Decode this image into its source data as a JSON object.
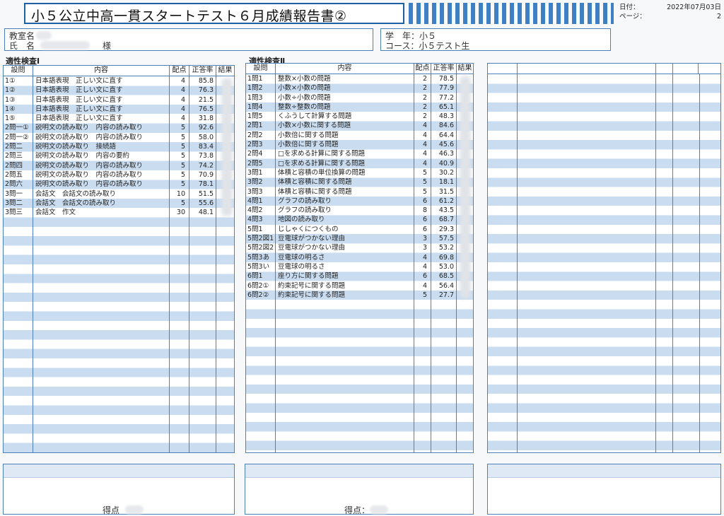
{
  "header": {
    "title": "小５公立中高一貫スタートテスト６月成績報告書②",
    "date_label": "日付：",
    "date_value": "2022年07月03日",
    "page_label": "ページ：",
    "page_value": "2"
  },
  "info": {
    "classroom_label": "教室名",
    "name_label": "氏　名",
    "honorific": "様",
    "grade_label": "学　年：",
    "grade_value": "小５",
    "course_label": "コース：",
    "course_value": "小５テスト生"
  },
  "table_headers": {
    "question": "設問",
    "content": "内容",
    "points": "配点",
    "rate": "正答率",
    "result": "結果"
  },
  "section1": {
    "title": "適性検査Ⅰ",
    "rows": [
      {
        "q": "1①",
        "c": "日本語表現　正しい文に直す",
        "p": "4",
        "r": "85.8"
      },
      {
        "q": "1②",
        "c": "日本語表現　正しい文に直す",
        "p": "4",
        "r": "76.3"
      },
      {
        "q": "1③",
        "c": "日本語表現　正しい文に直す",
        "p": "4",
        "r": "21.5"
      },
      {
        "q": "1④",
        "c": "日本語表現　正しい文に直す",
        "p": "4",
        "r": "76.5"
      },
      {
        "q": "1⑤",
        "c": "日本語表現　正しい文に直す",
        "p": "4",
        "r": "31.8"
      },
      {
        "q": "2問一①",
        "c": "説明文の読み取り　内容の読み取り",
        "p": "5",
        "r": "92.6"
      },
      {
        "q": "2問一②",
        "c": "説明文の読み取り　内容の読み取り",
        "p": "5",
        "r": "58.0"
      },
      {
        "q": "2問二",
        "c": "説明文の読み取り　接続語",
        "p": "5",
        "r": "83.4"
      },
      {
        "q": "2問三",
        "c": "説明文の読み取り　内容の要約",
        "p": "5",
        "r": "73.8"
      },
      {
        "q": "2問四",
        "c": "説明文の読み取り　内容の読み取り",
        "p": "5",
        "r": "74.2"
      },
      {
        "q": "2問五",
        "c": "説明文の読み取り　内容の読み取り",
        "p": "5",
        "r": "70.9"
      },
      {
        "q": "2問六",
        "c": "説明文の読み取り　内容の読み取り",
        "p": "5",
        "r": "78.1"
      },
      {
        "q": "3問一",
        "c": "会話文　会話文の読み取り",
        "p": "10",
        "r": "51.5"
      },
      {
        "q": "3問二",
        "c": "会話文　会話文の読み取り",
        "p": "5",
        "r": "55.6"
      },
      {
        "q": "3問三",
        "c": "会話文　作文",
        "p": "30",
        "r": "48.1"
      }
    ]
  },
  "section2": {
    "title": "適性検査Ⅱ",
    "rows": [
      {
        "q": "1問1",
        "c": "整数×小数の問題",
        "p": "2",
        "r": "78.5"
      },
      {
        "q": "1問2",
        "c": "小数×小数の問題",
        "p": "2",
        "r": "77.9"
      },
      {
        "q": "1問3",
        "c": "小数÷小数の問題",
        "p": "2",
        "r": "77.2"
      },
      {
        "q": "1問4",
        "c": "整数÷整数の問題",
        "p": "2",
        "r": "65.1"
      },
      {
        "q": "1問5",
        "c": "くふうして計算する問題",
        "p": "2",
        "r": "48.3"
      },
      {
        "q": "2問1",
        "c": "小数×小数に関する問題",
        "p": "4",
        "r": "84.6"
      },
      {
        "q": "2問2",
        "c": "小数倍に関する問題",
        "p": "4",
        "r": "64.4"
      },
      {
        "q": "2問3",
        "c": "小数倍に関する問題",
        "p": "4",
        "r": "45.6"
      },
      {
        "q": "2問4",
        "c": "□を求める計算に関する問題",
        "p": "4",
        "r": "46.3"
      },
      {
        "q": "2問5",
        "c": "□を求める計算に関する問題",
        "p": "4",
        "r": "40.9"
      },
      {
        "q": "3問1",
        "c": "体積と容積の単位換算の問題",
        "p": "5",
        "r": "30.2"
      },
      {
        "q": "3問2",
        "c": "体積と容積に関する問題",
        "p": "5",
        "r": "18.1"
      },
      {
        "q": "3問3",
        "c": "体積と容積に関する問題",
        "p": "5",
        "r": "31.5"
      },
      {
        "q": "4問1",
        "c": "グラフの読み取り",
        "p": "6",
        "r": "61.2"
      },
      {
        "q": "4問2",
        "c": "グラフの読み取り",
        "p": "8",
        "r": "43.5"
      },
      {
        "q": "4問3",
        "c": "地図の読み取り",
        "p": "6",
        "r": "68.7"
      },
      {
        "q": "5問1",
        "c": "じしゃくにつくもの",
        "p": "6",
        "r": "29.3"
      },
      {
        "q": "5問2図1",
        "c": "豆電球がつかない理由",
        "p": "3",
        "r": "57.5"
      },
      {
        "q": "5問2図2",
        "c": "豆電球がつかない理由",
        "p": "3",
        "r": "53.2"
      },
      {
        "q": "5問3あ",
        "c": "豆電球の明るさ",
        "p": "4",
        "r": "69.8"
      },
      {
        "q": "5問3い",
        "c": "豆電球の明るさ",
        "p": "4",
        "r": "53.0"
      },
      {
        "q": "6問1",
        "c": "座り方に関する問題",
        "p": "6",
        "r": "68.5"
      },
      {
        "q": "6問2①",
        "c": "約束記号に関する問題",
        "p": "4",
        "r": "56.4"
      },
      {
        "q": "6問2②",
        "c": "約束記号に関する問題",
        "p": "5",
        "r": "27.7"
      }
    ]
  },
  "scores": {
    "label1": "得点",
    "label2": "得点："
  }
}
